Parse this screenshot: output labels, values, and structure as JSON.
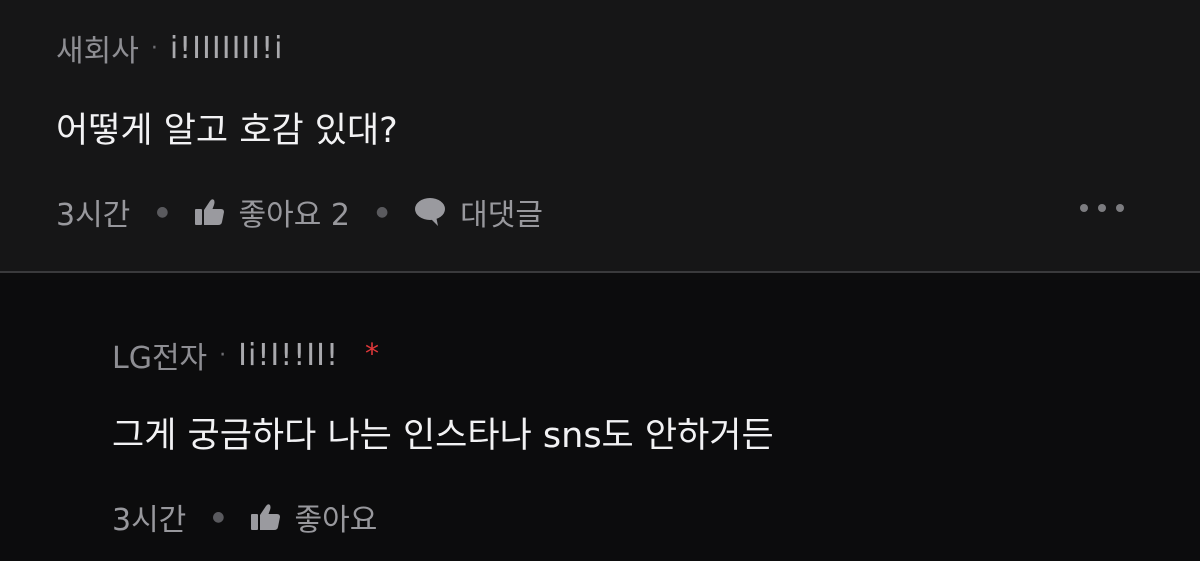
{
  "comment": {
    "author": "새회사",
    "separator": "·",
    "nickname": "i!IIIIIII!i",
    "text": "어떻게 알고 호감 있대?",
    "time": "3시간",
    "like_label": "좋아요 2",
    "reply_label": "대댓글",
    "more_icon": "more-horizontal-icon"
  },
  "reply": {
    "author": "LG전자",
    "separator": "·",
    "nickname": "Ii!I!!II!",
    "badge": "*",
    "text": "그게 궁금하다 나는 인스타나 sns도 안하거든",
    "time": "3시간",
    "like_label": "좋아요"
  },
  "colors": {
    "top_background": "#161617",
    "reply_background": "#0c0c0d",
    "badge": "#e0383a"
  }
}
